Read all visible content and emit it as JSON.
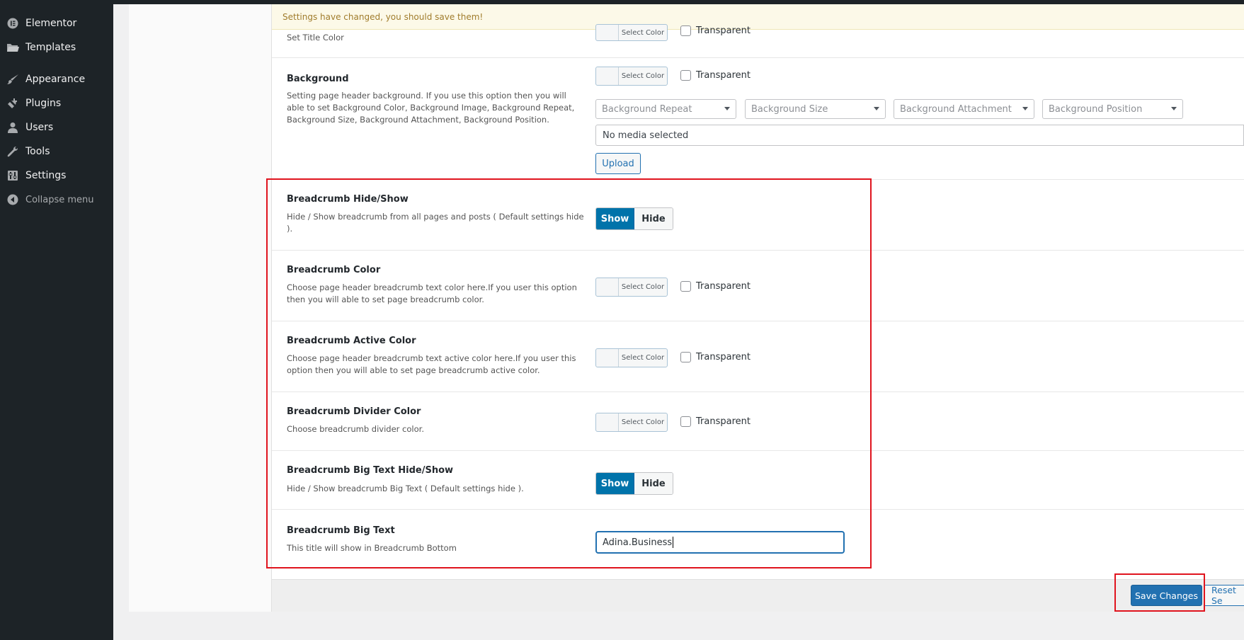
{
  "sidebar": {
    "items": [
      {
        "label": "Elementor",
        "icon": "elementor-icon"
      },
      {
        "label": "Templates",
        "icon": "folder-icon"
      },
      {
        "label": "Appearance",
        "icon": "paintbrush-icon"
      },
      {
        "label": "Plugins",
        "icon": "plug-icon"
      },
      {
        "label": "Users",
        "icon": "user-icon"
      },
      {
        "label": "Tools",
        "icon": "wrench-icon"
      },
      {
        "label": "Settings",
        "icon": "settings-icon"
      }
    ],
    "collapse_label": "Collapse menu"
  },
  "notice": "Settings have changed, you should save them!",
  "set_title_color": {
    "title": "Set Title Color",
    "picker_label": "Select Color",
    "transparent_label": "Transparent"
  },
  "background": {
    "title": "Background",
    "desc": "Setting page header background. If you use this option then you will able to set Background Color, Background Image, Background Repeat, Background Size, Background Attachment, Background Position.",
    "picker_label": "Select Color",
    "transparent_label": "Transparent",
    "selects": [
      "Background Repeat",
      "Background Size",
      "Background Attachment",
      "Background Position"
    ],
    "media_placeholder": "No media selected",
    "upload_label": "Upload"
  },
  "breadcrumb_hide_show": {
    "title": "Breadcrumb Hide/Show",
    "desc": "Hide / Show breadcrumb from all pages and posts ( Default settings hide ).",
    "show_label": "Show",
    "hide_label": "Hide",
    "selected": "Show"
  },
  "breadcrumb_color": {
    "title": "Breadcrumb Color",
    "desc": "Choose page header breadcrumb text color here.If you user this option then you will able to set page breadcrumb color.",
    "picker_label": "Select Color",
    "transparent_label": "Transparent"
  },
  "breadcrumb_active_color": {
    "title": "Breadcrumb Active Color",
    "desc": "Choose page header breadcrumb text active color here.If you user this option then you will able to set page breadcrumb active color.",
    "picker_label": "Select Color",
    "transparent_label": "Transparent"
  },
  "breadcrumb_divider_color": {
    "title": "Breadcrumb Divider Color",
    "desc": "Choose breadcrumb divider color.",
    "picker_label": "Select Color",
    "transparent_label": "Transparent"
  },
  "breadcrumb_big_text_hide_show": {
    "title": "Breadcrumb Big Text Hide/Show",
    "desc": "Hide / Show breadcrumb Big Text ( Default settings hide ).",
    "show_label": "Show",
    "hide_label": "Hide",
    "selected": "Show"
  },
  "breadcrumb_big_text": {
    "title": "Breadcrumb Big Text",
    "desc": "This title will show in Breadcrumb Bottom",
    "value": "Adina.Business"
  },
  "footer": {
    "save_label": "Save Changes",
    "reset_label": "Reset Se"
  },
  "colors": {
    "sidebar_bg": "#1d2327",
    "primary": "#2271b1",
    "toggle_on": "#0073aa",
    "highlight": "#e0141e",
    "notice_text": "#a07c2c"
  }
}
